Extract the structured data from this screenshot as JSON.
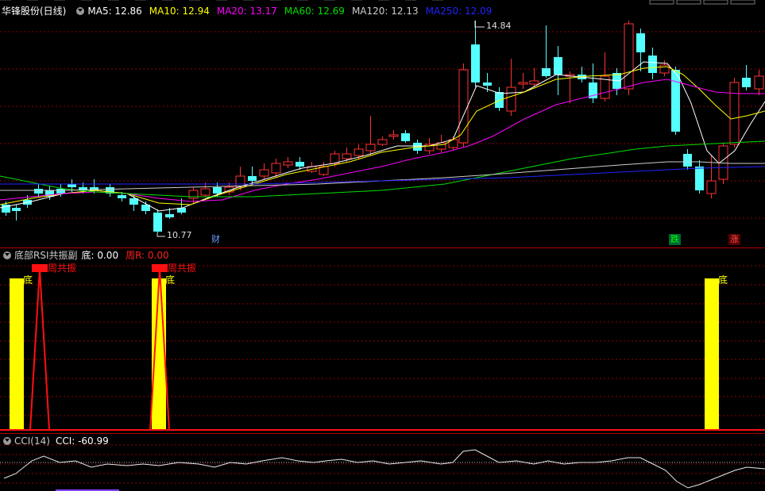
{
  "colors": {
    "up": "#ff3232",
    "down": "#54ffff",
    "ma5": "#ffffff",
    "ma10": "#ffff00",
    "ma20": "#ff00ff",
    "ma60": "#00e000",
    "ma120": "#cccccc",
    "ma250": "#2222ff",
    "grid": "#8b0000",
    "yellow": "#ffff00",
    "red": "#ff1010"
  },
  "main": {
    "title": "华锋股份(日线)",
    "ma": [
      {
        "label": "MA5: 12.86",
        "color": "#ffffff"
      },
      {
        "label": "MA10: 12.94",
        "color": "#ffff00"
      },
      {
        "label": "MA20: 13.17",
        "color": "#ff00ff"
      },
      {
        "label": "MA60: 12.69",
        "color": "#00e000"
      },
      {
        "label": "MA120: 12.13",
        "color": "#cccccc"
      },
      {
        "label": "MA250: 12.09",
        "color": "#2222ff"
      }
    ],
    "high_label": "14.84",
    "low_label": "10.77",
    "markers": {
      "cai": "财",
      "die": "跌",
      "zhang": "涨"
    }
  },
  "indicator": {
    "name": "底部RSI共振副",
    "di_label": "底: 0.00",
    "zhou_label": "周R: 0.00",
    "bar_label": "底",
    "flag_label": "周共振"
  },
  "cci": {
    "name": "CCI(14)",
    "value_label": "CCI: -60.99"
  }
}
